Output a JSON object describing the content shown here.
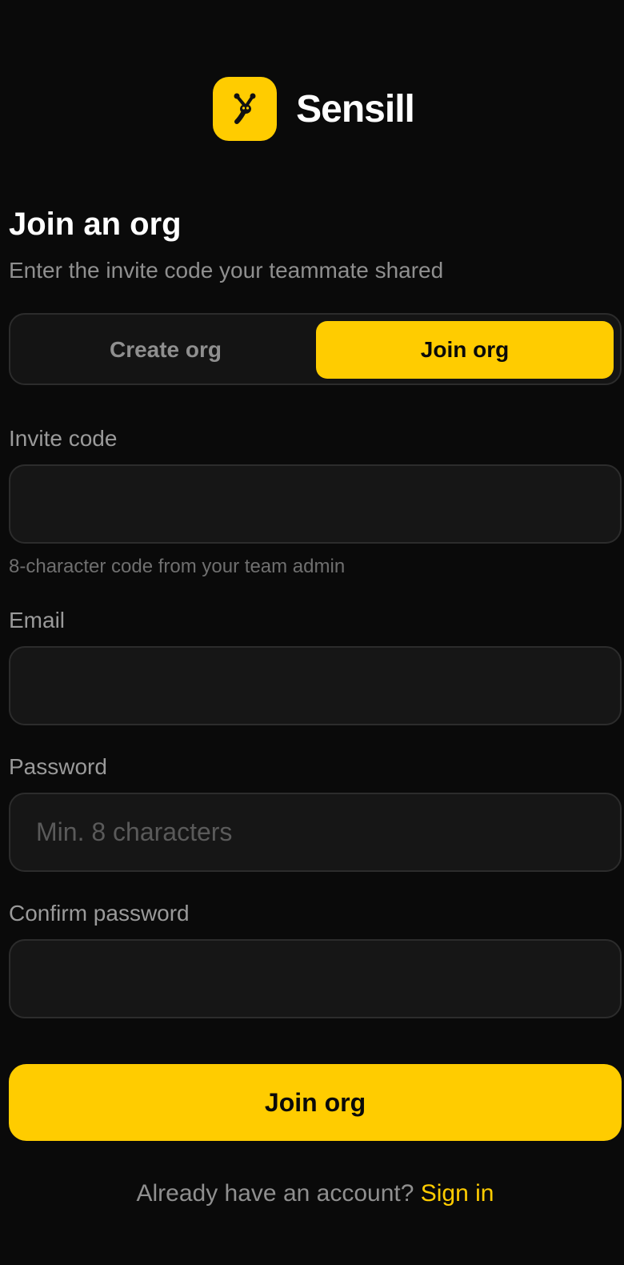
{
  "brand": {
    "name": "Sensill",
    "logo_icon": "insect-antenna-icon",
    "accent_color": "#ffcc00"
  },
  "page": {
    "title": "Join an org",
    "subtitle": "Enter the invite code your teammate shared"
  },
  "mode_toggle": {
    "options": [
      {
        "label": "Create org",
        "selected": false
      },
      {
        "label": "Join org",
        "selected": true
      }
    ]
  },
  "form": {
    "invite_code": {
      "label": "Invite code",
      "value": "",
      "placeholder": "",
      "hint": "8-character code from your team admin"
    },
    "email": {
      "label": "Email",
      "value": "",
      "placeholder": ""
    },
    "password": {
      "label": "Password",
      "value": "",
      "placeholder": "Min. 8 characters"
    },
    "confirm_password": {
      "label": "Confirm password",
      "value": "",
      "placeholder": ""
    },
    "submit_label": "Join org"
  },
  "footer": {
    "prompt": "Already have an account?",
    "link_label": "Sign in"
  }
}
